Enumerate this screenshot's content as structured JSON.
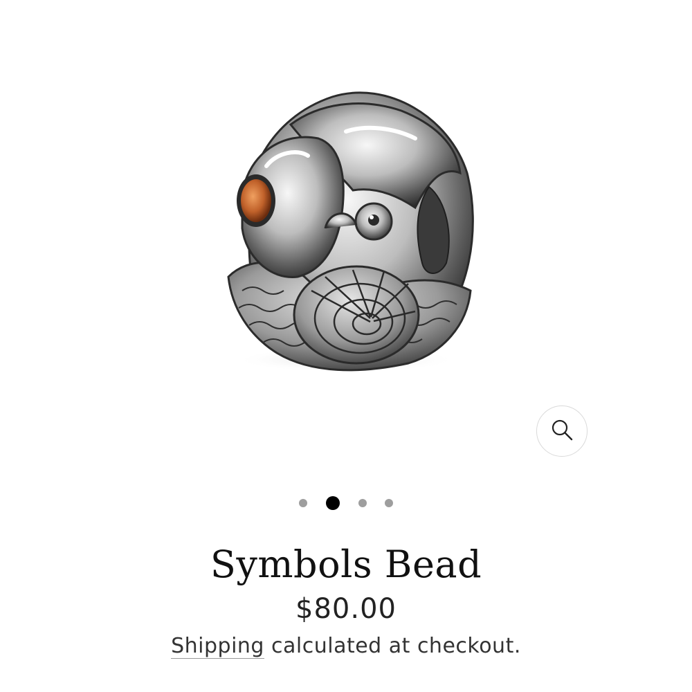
{
  "product": {
    "title": "Symbols Bead",
    "price": "$80.00",
    "shipping_link": "Shipping",
    "shipping_rest": " calculated at checkout."
  },
  "gallery": {
    "image_alt": "Symbols Bead",
    "zoom_icon": "search-icon",
    "dots_total": 4,
    "active_index": 1
  },
  "colors": {
    "accent": "#000000",
    "dot_inactive": "#9e9e9e",
    "gem": "#c0612a"
  }
}
